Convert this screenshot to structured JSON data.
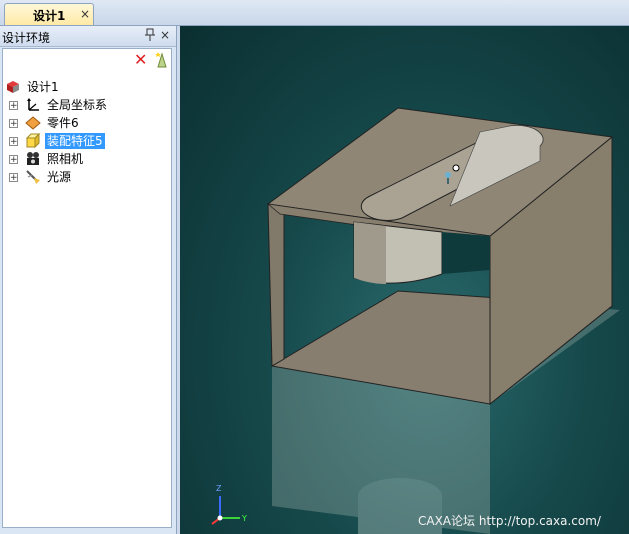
{
  "document_tab": {
    "label": "设计1",
    "close_glyph": "×"
  },
  "panel": {
    "title": "设计环境",
    "pin_glyph": "ᵖ",
    "close_glyph": "×",
    "toolbar": {
      "delete_glyph": "✕"
    }
  },
  "tree": {
    "root": {
      "label": "设计1"
    },
    "items": [
      {
        "label": "全局坐标系",
        "icon": "coordinate-system-icon",
        "expand": "+"
      },
      {
        "label": "零件6",
        "icon": "part-icon",
        "expand": "+"
      },
      {
        "label": "装配特征5",
        "icon": "assembly-feature-icon",
        "expand": "+",
        "selected": true
      },
      {
        "label": "照相机",
        "icon": "camera-icon",
        "expand": "+"
      },
      {
        "label": "光源",
        "icon": "light-source-icon",
        "expand": "+"
      }
    ]
  },
  "viewport": {
    "watermark": "CAXA论坛 http://top.caxa.com/",
    "axis_x": "Y",
    "axis_z": "Z"
  },
  "colors": {
    "selection": "#3399ff",
    "viewport_bg": "#16494b",
    "part_face": "#8a8270"
  }
}
